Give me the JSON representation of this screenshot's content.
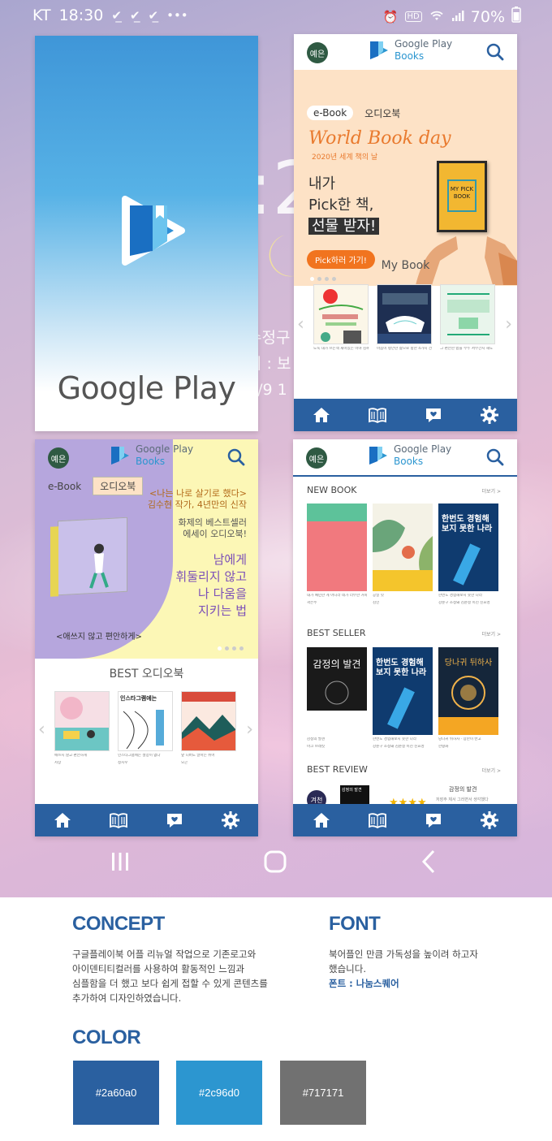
{
  "status": {
    "carrier": "KT",
    "time": "18:30",
    "battery": "70%",
    "hd": "HD"
  },
  "lockscreen": {
    "clock": ":2",
    "info1": "수정구",
    "info2": "지 : 보",
    "info3": "2/9 1"
  },
  "splash": {
    "name": "Google Play"
  },
  "app": {
    "badge": "예은",
    "logo_line1": "Google Play",
    "logo_line2": "Books",
    "tab_ebook": "e-Book",
    "tab_audio": "오디오북",
    "nav": [
      "home-icon",
      "library-icon",
      "review-icon",
      "settings-icon"
    ]
  },
  "screen2": {
    "banner_title": "World Book day",
    "banner_sub": "2020년 세계 책의 날",
    "line1": "내가",
    "line2": "Pick한 책,",
    "line3": "선물 받자!",
    "button": "Pick하러 가기!",
    "book_label": "MY PICK BOOK",
    "section": "My Book",
    "books": [
      {
        "title": "도둑 내가 쓰는책 재미있는 이야 김혜남"
      },
      {
        "title": "마음이 평안한 삶으로 향한 4가지 건강한 비밀"
      },
      {
        "title": "그 편안한 밤을 부두 서부간지 해도"
      }
    ]
  },
  "screen3": {
    "quote1": "<나는 나로 살기로 했다>",
    "quote2": "김수현 작가, 4년만의 신작",
    "quote3": "화제의 베스트셀러",
    "quote4": "에세이 오디오북!",
    "big1": "남에게",
    "big2": "휘둘리지 않고",
    "big3": "나 다움을",
    "big4": "지키는 법",
    "caption": "<애쓰지 않고 편안하게>",
    "section": "BEST 오디오북",
    "books": [
      {
        "title": "애쓰지 않고 편안하게",
        "author": "저장"
      },
      {
        "title": "인스타그램에는 절망이 없다",
        "author": "정지우"
      },
      {
        "title": "앞 니버도 알아는 쉬어",
        "author": "오곤"
      }
    ],
    "cover2_text": "인스타그램에는"
  },
  "screen4": {
    "sec1": "NEW BOOK",
    "sec2": "BEST SELLER",
    "sec3": "BEST REVIEW",
    "more": "더보기 >",
    "new_books": [
      {
        "title": "내가 예민한 게 아니라 네가 너무한 거야",
        "author": "곽은주"
      },
      {
        "title": "공일 잇",
        "author": "김인"
      },
      {
        "title": "한번도 경험해보지 못한 나라",
        "author": "강준구 조정돼 김준결 이진 진효영"
      }
    ],
    "best_books": [
      {
        "title": "감정의 발견",
        "author": "마크 브래킷"
      },
      {
        "title": "한번도 경험해보지 못한 나라",
        "author": "강준구 조정돼 김준결 이진 진효영"
      },
      {
        "title": "당나귀 뒤하사 · 장만이 반고",
        "author": "한왕화"
      }
    ],
    "cover_new3": "한번도 경험해보지 못한 나라",
    "cover_best1": "감정의 발견",
    "cover_best2": "한번도 경험해보지 못한 나라",
    "cover_best3": "당나귀 뒤하사",
    "review_title": "감정의 발견",
    "review_sub": "저장주 체서 그러면서 생각했다",
    "review_avatar": "겨천",
    "review_book": "감정의 발견"
  },
  "concept": {
    "heading": "CONCEPT",
    "lines": [
      "구글플레이북 어플 리뉴얼 작업으로 기존로고와",
      "아이덴티티컬러를 사용하여 활동적인 느낌과",
      "심플함을 더 했고 보다 쉽게 접할 수 있게 콘텐츠를",
      "추가하여 디자인하였습니다."
    ]
  },
  "font": {
    "heading": "FONT",
    "lines": [
      "북어플인 만큼 가독성을 높이려 하고자",
      "했습니다."
    ],
    "font_label": "폰트 : 나눔스퀘어"
  },
  "color": {
    "heading": "COLOR",
    "swatches": [
      {
        "hex": "#2a60a0",
        "label": "#2a60a0"
      },
      {
        "hex": "#2c96d0",
        "label": "#2c96d0"
      },
      {
        "hex": "#717171",
        "label": "#717171"
      }
    ]
  }
}
